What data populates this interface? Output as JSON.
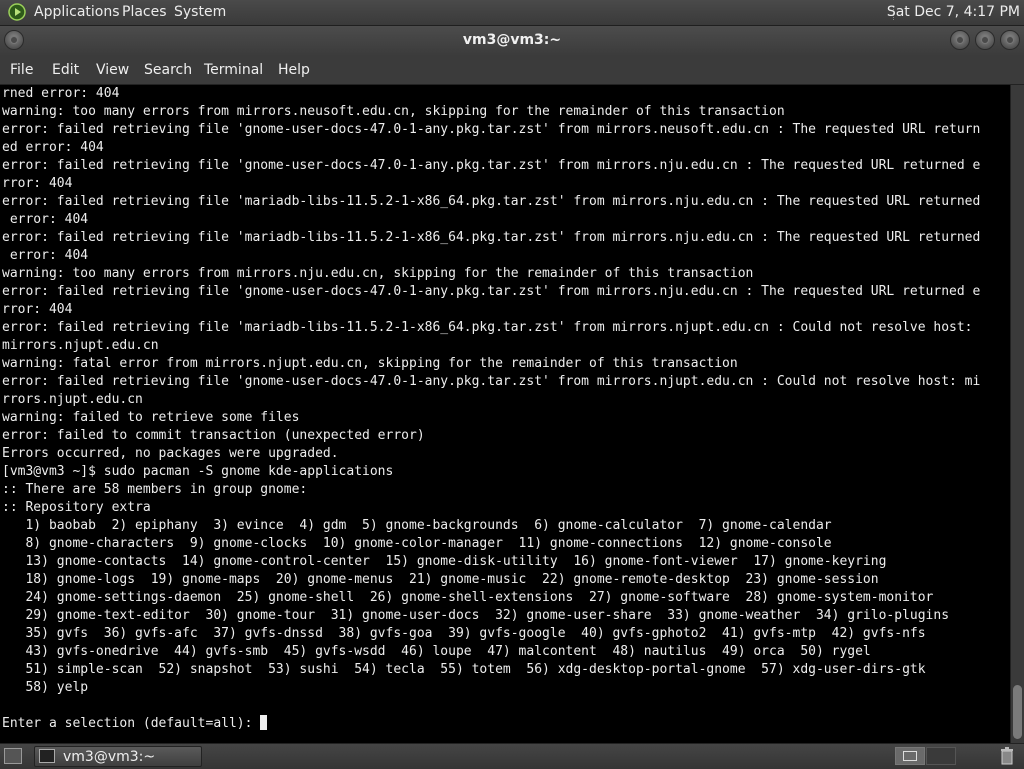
{
  "top_panel": {
    "menus": [
      "Applications",
      "Places",
      "System"
    ],
    "clock": "Sat Dec  7,  4:17 PM"
  },
  "window": {
    "title": "vm3@vm3:~"
  },
  "menubar": {
    "items": [
      "File",
      "Edit",
      "View",
      "Search",
      "Terminal",
      "Help"
    ]
  },
  "terminal": {
    "lines": [
      "rned error: 404",
      "warning: too many errors from mirrors.neusoft.edu.cn, skipping for the remainder of this transaction",
      "error: failed retrieving file 'gnome-user-docs-47.0-1-any.pkg.tar.zst' from mirrors.neusoft.edu.cn : The requested URL return",
      "ed error: 404",
      "error: failed retrieving file 'gnome-user-docs-47.0-1-any.pkg.tar.zst' from mirrors.nju.edu.cn : The requested URL returned e",
      "rror: 404",
      "error: failed retrieving file 'mariadb-libs-11.5.2-1-x86_64.pkg.tar.zst' from mirrors.nju.edu.cn : The requested URL returned",
      " error: 404",
      "error: failed retrieving file 'mariadb-libs-11.5.2-1-x86_64.pkg.tar.zst' from mirrors.nju.edu.cn : The requested URL returned",
      " error: 404",
      "warning: too many errors from mirrors.nju.edu.cn, skipping for the remainder of this transaction",
      "error: failed retrieving file 'gnome-user-docs-47.0-1-any.pkg.tar.zst' from mirrors.nju.edu.cn : The requested URL returned e",
      "rror: 404",
      "error: failed retrieving file 'mariadb-libs-11.5.2-1-x86_64.pkg.tar.zst' from mirrors.njupt.edu.cn : Could not resolve host:",
      "mirrors.njupt.edu.cn",
      "warning: fatal error from mirrors.njupt.edu.cn, skipping for the remainder of this transaction",
      "error: failed retrieving file 'gnome-user-docs-47.0-1-any.pkg.tar.zst' from mirrors.njupt.edu.cn : Could not resolve host: mi",
      "rrors.njupt.edu.cn",
      "warning: failed to retrieve some files",
      "error: failed to commit transaction (unexpected error)",
      "Errors occurred, no packages were upgraded.",
      "[vm3@vm3 ~]$ sudo pacman -S gnome kde-applications",
      ":: There are 58 members in group gnome:",
      ":: Repository extra",
      "   1) baobab  2) epiphany  3) evince  4) gdm  5) gnome-backgrounds  6) gnome-calculator  7) gnome-calendar",
      "   8) gnome-characters  9) gnome-clocks  10) gnome-color-manager  11) gnome-connections  12) gnome-console",
      "   13) gnome-contacts  14) gnome-control-center  15) gnome-disk-utility  16) gnome-font-viewer  17) gnome-keyring",
      "   18) gnome-logs  19) gnome-maps  20) gnome-menus  21) gnome-music  22) gnome-remote-desktop  23) gnome-session",
      "   24) gnome-settings-daemon  25) gnome-shell  26) gnome-shell-extensions  27) gnome-software  28) gnome-system-monitor",
      "   29) gnome-text-editor  30) gnome-tour  31) gnome-user-docs  32) gnome-user-share  33) gnome-weather  34) grilo-plugins",
      "   35) gvfs  36) gvfs-afc  37) gvfs-dnssd  38) gvfs-goa  39) gvfs-google  40) gvfs-gphoto2  41) gvfs-mtp  42) gvfs-nfs",
      "   43) gvfs-onedrive  44) gvfs-smb  45) gvfs-wsdd  46) loupe  47) malcontent  48) nautilus  49) orca  50) rygel",
      "   51) simple-scan  52) snapshot  53) sushi  54) tecla  55) totem  56) xdg-desktop-portal-gnome  57) xdg-user-dirs-gtk",
      "   58) yelp",
      ""
    ],
    "prompt": "Enter a selection (default=all): "
  },
  "bottom_panel": {
    "task_label": "vm3@vm3:~"
  }
}
